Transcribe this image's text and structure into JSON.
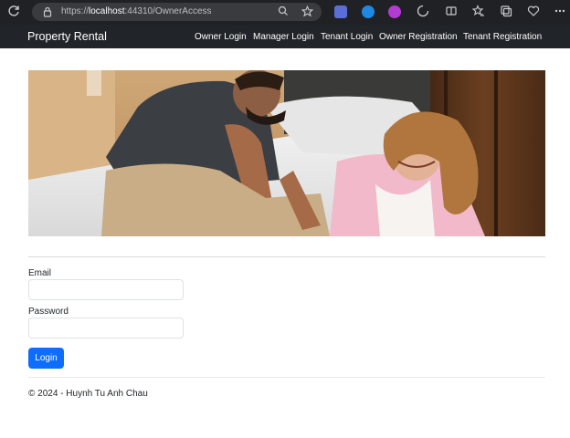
{
  "browser": {
    "url_prefix": "https://",
    "url_host": "localhost",
    "url_rest": ":44310/OwnerAccess"
  },
  "navbar": {
    "brand": "Property Rental",
    "links": [
      "Owner Login",
      "Manager Login",
      "Tenant Login",
      "Owner Registration",
      "Tenant Registration"
    ]
  },
  "form": {
    "email_label": "Email",
    "email_value": "",
    "password_label": "Password",
    "password_value": "",
    "login_button": "Login"
  },
  "footer": {
    "text": "© 2024 - Huynh Tu Anh Chau"
  },
  "colors": {
    "navbar_bg": "#212529",
    "primary": "#0d6efd",
    "browser_bg": "#202124"
  },
  "icons": [
    "refresh-icon",
    "lock-icon",
    "zoom-icon",
    "star-icon",
    "split-screen-icon",
    "favorites-icon",
    "collections-icon",
    "browser-essentials-icon",
    "more-icon"
  ]
}
